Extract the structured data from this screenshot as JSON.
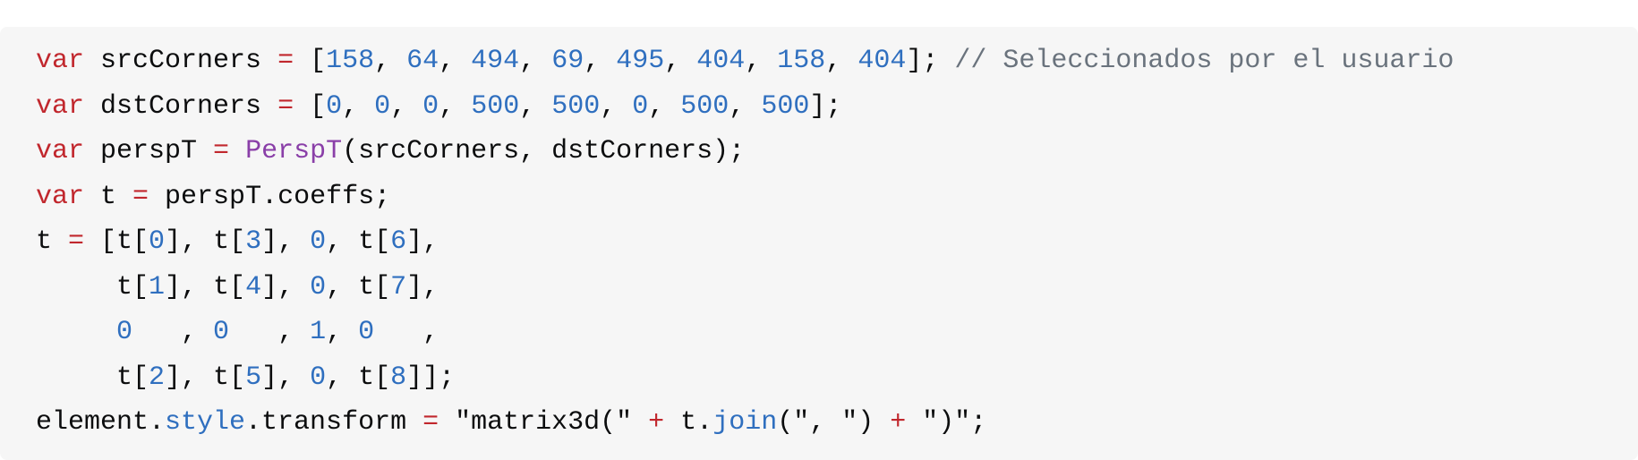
{
  "code_block": {
    "language": "javascript",
    "colors": {
      "background": "#f6f6f6",
      "plain": "#0c0d0e",
      "keyword": "#c1272d",
      "operator": "#c1272d",
      "number": "#2f6fbf",
      "function": "#8a3fa8",
      "property": "#2f6fbf",
      "comment": "#6a737d",
      "string": "#0c0d0e"
    },
    "lines": [
      {
        "tokens": [
          {
            "text": "var",
            "type": "keyword"
          },
          {
            "text": " srcCorners ",
            "type": "plain"
          },
          {
            "text": "=",
            "type": "operator"
          },
          {
            "text": " [",
            "type": "plain"
          },
          {
            "text": "158",
            "type": "number"
          },
          {
            "text": ", ",
            "type": "plain"
          },
          {
            "text": "64",
            "type": "number"
          },
          {
            "text": ", ",
            "type": "plain"
          },
          {
            "text": "494",
            "type": "number"
          },
          {
            "text": ", ",
            "type": "plain"
          },
          {
            "text": "69",
            "type": "number"
          },
          {
            "text": ", ",
            "type": "plain"
          },
          {
            "text": "495",
            "type": "number"
          },
          {
            "text": ", ",
            "type": "plain"
          },
          {
            "text": "404",
            "type": "number"
          },
          {
            "text": ", ",
            "type": "plain"
          },
          {
            "text": "158",
            "type": "number"
          },
          {
            "text": ", ",
            "type": "plain"
          },
          {
            "text": "404",
            "type": "number"
          },
          {
            "text": "]; ",
            "type": "plain"
          },
          {
            "text": "// Seleccionados por el usuario",
            "type": "comment"
          }
        ]
      },
      {
        "tokens": [
          {
            "text": "var",
            "type": "keyword"
          },
          {
            "text": " dstCorners ",
            "type": "plain"
          },
          {
            "text": "=",
            "type": "operator"
          },
          {
            "text": " [",
            "type": "plain"
          },
          {
            "text": "0",
            "type": "number"
          },
          {
            "text": ", ",
            "type": "plain"
          },
          {
            "text": "0",
            "type": "number"
          },
          {
            "text": ", ",
            "type": "plain"
          },
          {
            "text": "0",
            "type": "number"
          },
          {
            "text": ", ",
            "type": "plain"
          },
          {
            "text": "500",
            "type": "number"
          },
          {
            "text": ", ",
            "type": "plain"
          },
          {
            "text": "500",
            "type": "number"
          },
          {
            "text": ", ",
            "type": "plain"
          },
          {
            "text": "0",
            "type": "number"
          },
          {
            "text": ", ",
            "type": "plain"
          },
          {
            "text": "500",
            "type": "number"
          },
          {
            "text": ", ",
            "type": "plain"
          },
          {
            "text": "500",
            "type": "number"
          },
          {
            "text": "];",
            "type": "plain"
          }
        ]
      },
      {
        "tokens": [
          {
            "text": "var",
            "type": "keyword"
          },
          {
            "text": " perspT ",
            "type": "plain"
          },
          {
            "text": "=",
            "type": "operator"
          },
          {
            "text": " ",
            "type": "plain"
          },
          {
            "text": "PerspT",
            "type": "function"
          },
          {
            "text": "(srcCorners, dstCorners);",
            "type": "plain"
          }
        ]
      },
      {
        "tokens": [
          {
            "text": "var",
            "type": "keyword"
          },
          {
            "text": " t ",
            "type": "plain"
          },
          {
            "text": "=",
            "type": "operator"
          },
          {
            "text": " perspT.coeffs;",
            "type": "plain"
          }
        ]
      },
      {
        "tokens": [
          {
            "text": "t ",
            "type": "plain"
          },
          {
            "text": "=",
            "type": "operator"
          },
          {
            "text": " [t[",
            "type": "plain"
          },
          {
            "text": "0",
            "type": "number"
          },
          {
            "text": "], t[",
            "type": "plain"
          },
          {
            "text": "3",
            "type": "number"
          },
          {
            "text": "], ",
            "type": "plain"
          },
          {
            "text": "0",
            "type": "number"
          },
          {
            "text": ", t[",
            "type": "plain"
          },
          {
            "text": "6",
            "type": "number"
          },
          {
            "text": "],",
            "type": "plain"
          }
        ]
      },
      {
        "tokens": [
          {
            "text": "     t[",
            "type": "plain"
          },
          {
            "text": "1",
            "type": "number"
          },
          {
            "text": "], t[",
            "type": "plain"
          },
          {
            "text": "4",
            "type": "number"
          },
          {
            "text": "], ",
            "type": "plain"
          },
          {
            "text": "0",
            "type": "number"
          },
          {
            "text": ", t[",
            "type": "plain"
          },
          {
            "text": "7",
            "type": "number"
          },
          {
            "text": "],",
            "type": "plain"
          }
        ]
      },
      {
        "tokens": [
          {
            "text": "     ",
            "type": "plain"
          },
          {
            "text": "0",
            "type": "number"
          },
          {
            "text": "   , ",
            "type": "plain"
          },
          {
            "text": "0",
            "type": "number"
          },
          {
            "text": "   , ",
            "type": "plain"
          },
          {
            "text": "1",
            "type": "number"
          },
          {
            "text": ", ",
            "type": "plain"
          },
          {
            "text": "0",
            "type": "number"
          },
          {
            "text": "   ,",
            "type": "plain"
          }
        ]
      },
      {
        "tokens": [
          {
            "text": "     t[",
            "type": "plain"
          },
          {
            "text": "2",
            "type": "number"
          },
          {
            "text": "], t[",
            "type": "plain"
          },
          {
            "text": "5",
            "type": "number"
          },
          {
            "text": "], ",
            "type": "plain"
          },
          {
            "text": "0",
            "type": "number"
          },
          {
            "text": ", t[",
            "type": "plain"
          },
          {
            "text": "8",
            "type": "number"
          },
          {
            "text": "]];",
            "type": "plain"
          }
        ]
      },
      {
        "tokens": [
          {
            "text": "element.",
            "type": "plain"
          },
          {
            "text": "style",
            "type": "property"
          },
          {
            "text": ".transform ",
            "type": "plain"
          },
          {
            "text": "=",
            "type": "operator"
          },
          {
            "text": " \"matrix3d(\" ",
            "type": "string"
          },
          {
            "text": "+",
            "type": "operator"
          },
          {
            "text": " t.",
            "type": "plain"
          },
          {
            "text": "join",
            "type": "property"
          },
          {
            "text": "(\", \") ",
            "type": "string"
          },
          {
            "text": "+",
            "type": "operator"
          },
          {
            "text": " \")\";",
            "type": "string"
          }
        ]
      }
    ]
  }
}
